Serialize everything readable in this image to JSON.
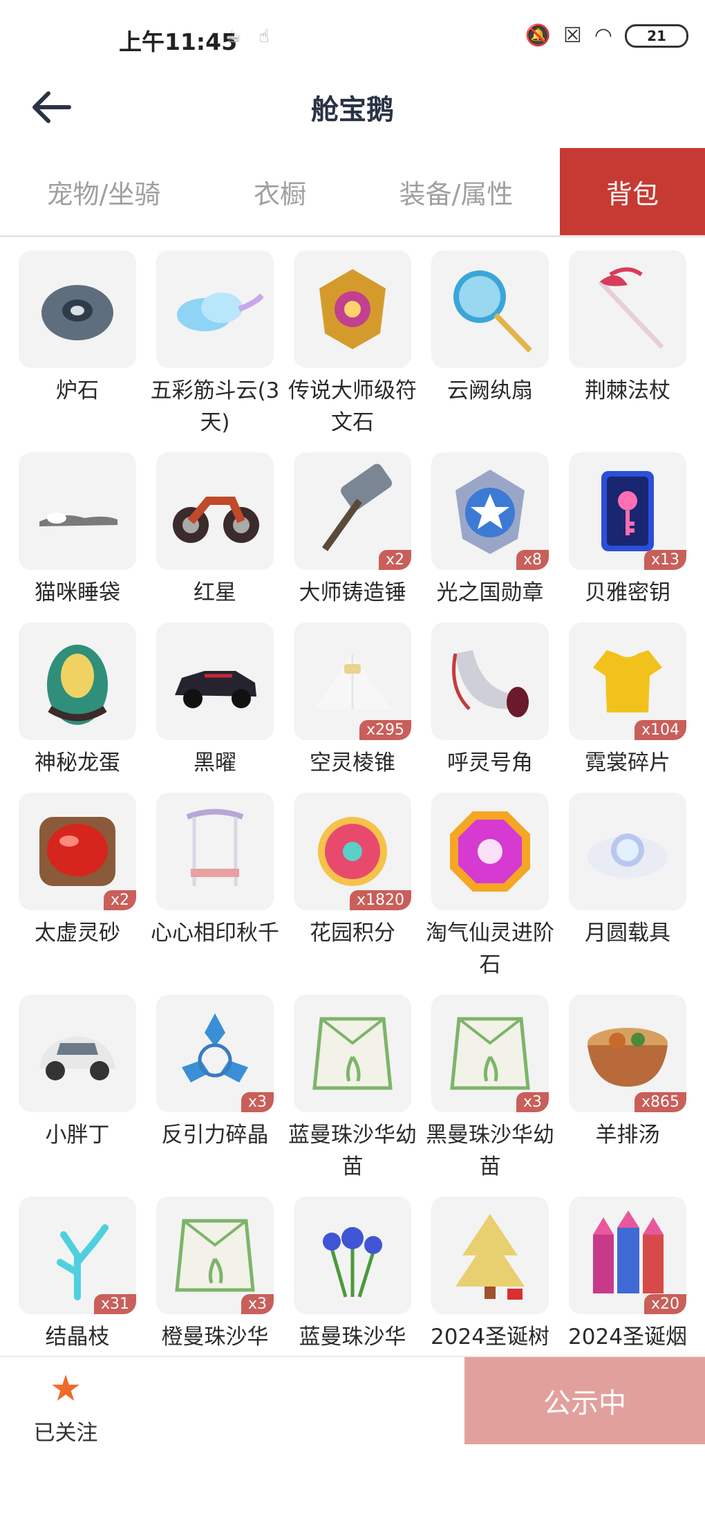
{
  "status_bar": {
    "time": "上午11:45",
    "battery": "21",
    "icons": [
      "notification-app-icon",
      "notification-hand-icon",
      "mute-icon",
      "sim-icon",
      "wifi-icon",
      "battery-icon"
    ]
  },
  "header": {
    "title": "舱宝鹅",
    "back_icon": "back-arrow-icon"
  },
  "tabs": [
    {
      "label": "宠物/坐骑",
      "active": false
    },
    {
      "label": "衣橱",
      "active": false
    },
    {
      "label": "装备/属性",
      "active": false
    },
    {
      "label": "背包",
      "active": true
    }
  ],
  "accent_color": "#c63a34",
  "items": [
    {
      "name": "炉石",
      "count": "",
      "icon": "stone-icon",
      "color": "#5f6e7c"
    },
    {
      "name": "五彩筋斗云(3天)",
      "count": "",
      "icon": "cloud-icon",
      "color": "#8fd3f5"
    },
    {
      "name": "传说大师级符文石",
      "count": "",
      "icon": "rune-icon",
      "color": "#d49b2c"
    },
    {
      "name": "云阙纨扇",
      "count": "",
      "icon": "fan-icon",
      "color": "#3aa6d8"
    },
    {
      "name": "荆棘法杖",
      "count": "",
      "icon": "staff-icon",
      "color": "#d83c5a"
    },
    {
      "name": "猫咪睡袋",
      "count": "",
      "icon": "sleeping-bag-icon",
      "color": "#7a7a7a"
    },
    {
      "name": "红星",
      "count": "",
      "icon": "motorcycle-icon",
      "color": "#3b2b2a"
    },
    {
      "name": "大师铸造锤",
      "count": "x2",
      "icon": "hammer-icon",
      "color": "#7b8694"
    },
    {
      "name": "光之国勋章",
      "count": "x8",
      "icon": "medal-icon",
      "color": "#3d7ad6"
    },
    {
      "name": "贝雅密钥",
      "count": "x13",
      "icon": "key-card-icon",
      "color": "#2b4fd8"
    },
    {
      "name": "神秘龙蛋",
      "count": "",
      "icon": "dragon-egg-icon",
      "color": "#2f8f7a"
    },
    {
      "name": "黑曜",
      "count": "",
      "icon": "car-icon",
      "color": "#26232f"
    },
    {
      "name": "空灵棱锥",
      "count": "x295",
      "icon": "pyramid-icon",
      "color": "#e8d48a"
    },
    {
      "name": "呼灵号角",
      "count": "",
      "icon": "horn-icon",
      "color": "#cfcfd8"
    },
    {
      "name": "霓裳碎片",
      "count": "x104",
      "icon": "shirt-icon",
      "color": "#f2c21c"
    },
    {
      "name": "太虚灵砂",
      "count": "x2",
      "icon": "red-gem-icon",
      "color": "#d6251d"
    },
    {
      "name": "心心相印秋千",
      "count": "",
      "icon": "swing-icon",
      "color": "#b8a6d6"
    },
    {
      "name": "花园积分",
      "count": "x1820",
      "icon": "flower-badge-icon",
      "color": "#e84a6e"
    },
    {
      "name": "淘气仙灵进阶石",
      "count": "",
      "icon": "octagon-gem-icon",
      "color": "#d63ad0"
    },
    {
      "name": "月圆载具",
      "count": "",
      "icon": "moon-cloud-icon",
      "color": "#b9c7ef"
    },
    {
      "name": "小胖丁",
      "count": "",
      "icon": "beetle-car-icon",
      "color": "#e8e8e8"
    },
    {
      "name": "反引力碎晶",
      "count": "x3",
      "icon": "crystal-shard-icon",
      "color": "#3a8fd6"
    },
    {
      "name": "蓝曼珠沙华幼苗",
      "count": "",
      "icon": "seed-bag-icon",
      "color": "#7db46a"
    },
    {
      "name": "黑曼珠沙华幼苗",
      "count": "x3",
      "icon": "seed-bag-icon",
      "color": "#7db46a"
    },
    {
      "name": "羊排汤",
      "count": "x865",
      "icon": "soup-bowl-icon",
      "color": "#c86a2a"
    },
    {
      "name": "结晶枝",
      "count": "x31",
      "icon": "crystal-branch-icon",
      "color": "#4fd0de"
    },
    {
      "name": "橙曼珠沙华",
      "count": "x3",
      "icon": "seed-bag-icon",
      "color": "#7db46a"
    },
    {
      "name": "蓝曼珠沙华",
      "count": "",
      "icon": "blue-flower-icon",
      "color": "#3f55d6"
    },
    {
      "name": "2024圣诞树",
      "count": "",
      "icon": "christmas-tree-icon",
      "color": "#e8d070"
    },
    {
      "name": "2024圣诞烟",
      "count": "x20",
      "icon": "firework-icon",
      "color": "#c8398a"
    }
  ],
  "bottom_bar": {
    "follow_label": "已关注",
    "follow_icon": "star-icon",
    "public_button": "公示中"
  }
}
